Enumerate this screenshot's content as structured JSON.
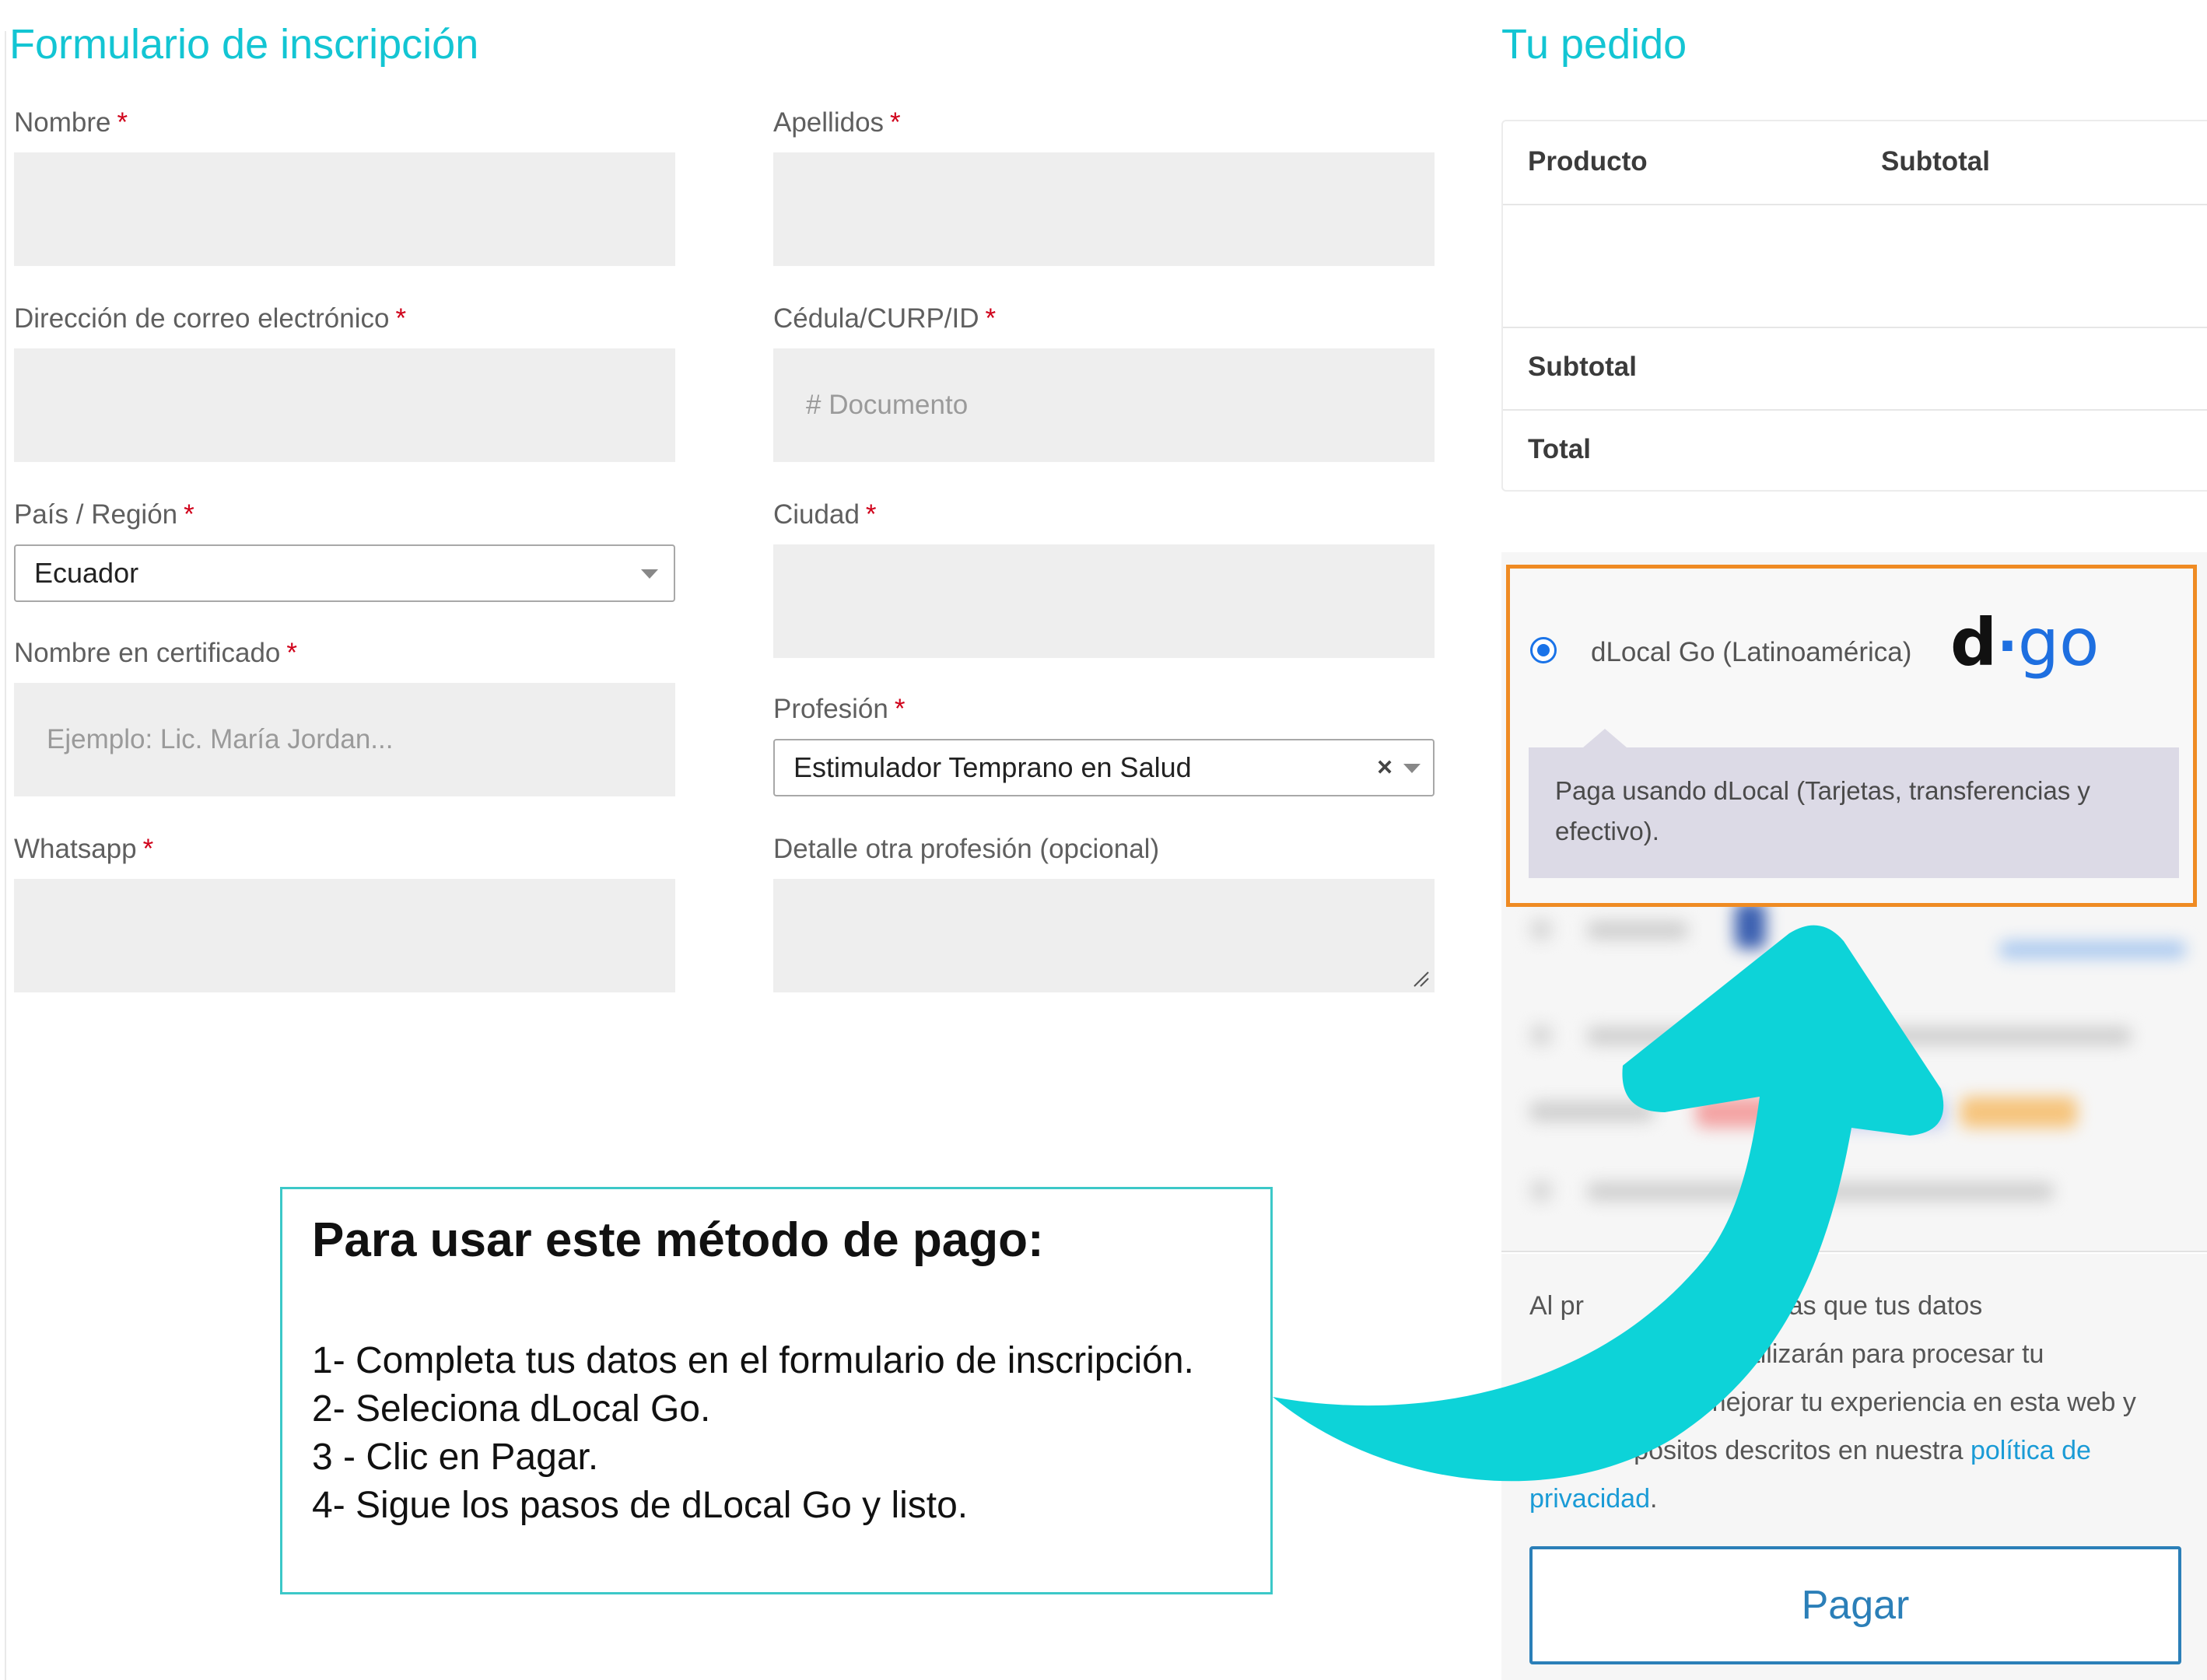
{
  "form": {
    "title": "Formulario de inscripción",
    "required_mark": "*",
    "nombre_label": "Nombre",
    "apellidos_label": "Apellidos",
    "email_label": "Dirección de correo electrónico",
    "cedula_label": "Cédula/CURP/ID",
    "cedula_placeholder": "# Documento",
    "pais_label": "País / Región",
    "pais_value": "Ecuador",
    "ciudad_label": "Ciudad",
    "certificado_label": "Nombre en certificado",
    "certificado_placeholder": "Ejemplo: Lic. María Jordan...",
    "profesion_label": "Profesión",
    "profesion_value": "Estimulador Temprano en Salud",
    "profesion_clear": "×",
    "whatsapp_label": "Whatsapp",
    "detalle_label": "Detalle otra profesión (opcional)"
  },
  "order": {
    "title": "Tu pedido",
    "col_product": "Producto",
    "col_subtotal": "Subtotal",
    "row_subtotal": "Subtotal",
    "row_total": "Total"
  },
  "payment": {
    "method_label": "dLocal Go (Latinoamérica)",
    "logo_d": "d",
    "logo_dot": "·",
    "logo_go": "go",
    "description": "Paga usando dLocal (Tarjetas, transferencias y efectivo).",
    "accent_color": "#ef8b23",
    "radio_color": "#1a73e8"
  },
  "privacy": {
    "line1": "Al pr",
    "line1_b": "ar aceptas que tus datos",
    "line2": "e utilizarán para procesar tu",
    "line3": "ión, mejorar tu experiencia en esta web y",
    "line4": "otros propósitos descritos en nuestra",
    "link1": "política de",
    "link2": "privacidad",
    "period": "."
  },
  "pay_button": {
    "label": "Pagar"
  },
  "instructions": {
    "title": "Para usar este método de pago:",
    "steps": [
      "1- Completa tus datos en el formulario de inscripción.",
      "2- Seleciona dLocal Go.",
      "3 - Clic en Pagar.",
      "4- Sigue los pasos de dLocal Go y listo."
    ]
  },
  "arrow": {
    "color": "#0dd3d8"
  }
}
